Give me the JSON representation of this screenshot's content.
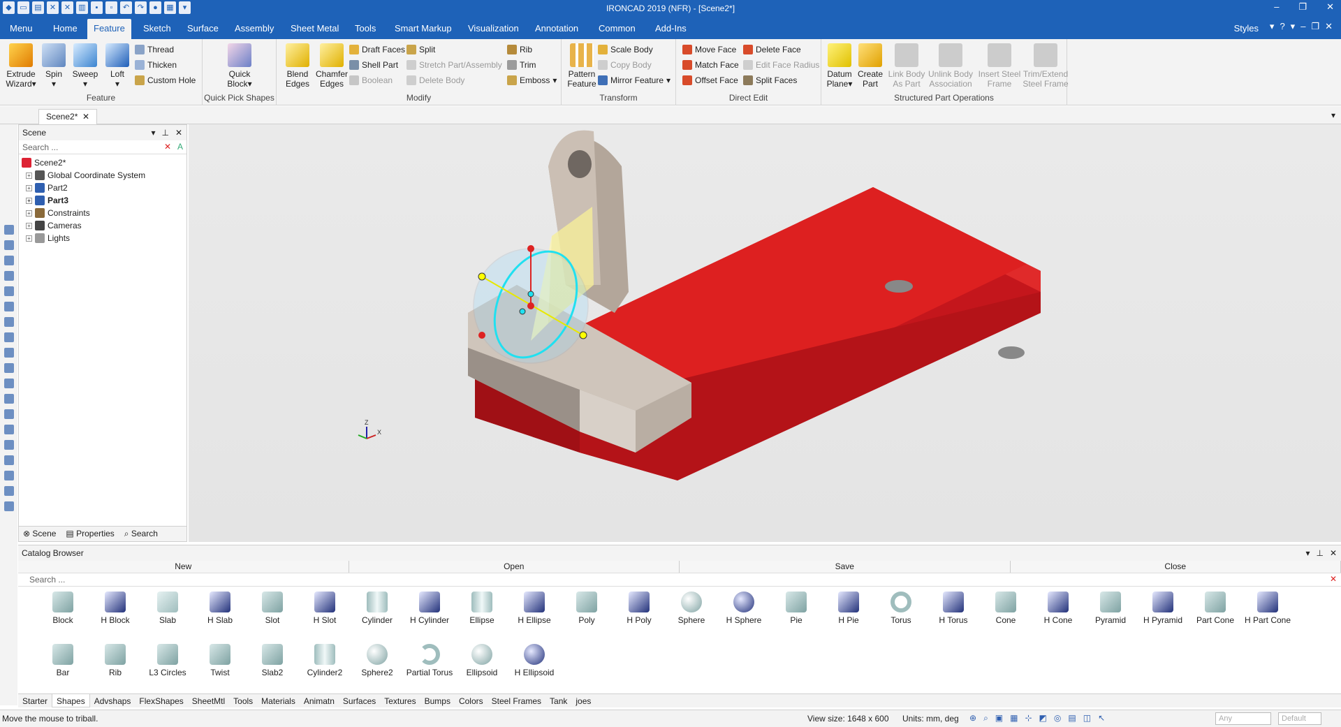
{
  "app": {
    "title": "IRONCAD 2019 (NFR) - [Scene2*]"
  },
  "menu": {
    "items": [
      "Menu",
      "Home",
      "Feature",
      "Sketch",
      "Surface",
      "Assembly",
      "Sheet Metal",
      "Tools",
      "Smart Markup",
      "Visualization",
      "Annotation",
      "Common",
      "Add-Ins"
    ],
    "active": "Feature",
    "styles": "Styles"
  },
  "ribbon": {
    "feature": {
      "label": "Feature",
      "extrude_1": "Extrude",
      "extrude_2": "Wizard",
      "spin": "Spin",
      "sweep": "Sweep",
      "loft": "Loft",
      "thread": "Thread",
      "thicken": "Thicken",
      "custom_hole": "Custom Hole"
    },
    "quick_pick": {
      "label": "Quick Pick Shapes",
      "quick_1": "Quick",
      "quick_2": "Block"
    },
    "modify": {
      "label": "Modify",
      "blend_1": "Blend",
      "blend_2": "Edges",
      "chamfer_1": "Chamfer",
      "chamfer_2": "Edges",
      "draft_faces": "Draft Faces",
      "shell_part": "Shell Part",
      "boolean": "Boolean",
      "split": "Split",
      "stretch": "Stretch Part/Assembly",
      "delete_body": "Delete Body",
      "rib": "Rib",
      "trim": "Trim",
      "emboss": "Emboss"
    },
    "transform": {
      "label": "Transform",
      "pattern_1": "Pattern",
      "pattern_2": "Feature",
      "scale_body": "Scale Body",
      "copy_body": "Copy Body",
      "mirror_feature": "Mirror Feature"
    },
    "direct_edit": {
      "label": "Direct Edit",
      "move_face": "Move Face",
      "match_face": "Match Face",
      "offset_face": "Offset Face",
      "delete_face": "Delete Face",
      "edit_face_radius": "Edit Face Radius",
      "split_faces": "Split Faces"
    },
    "structured": {
      "label": "Structured Part Operations",
      "datum_1": "Datum",
      "datum_2": "Plane",
      "create_1": "Create",
      "create_2": "Part",
      "link_1": "Link Body",
      "link_2": "As Part",
      "unlink_1": "Unlink Body",
      "unlink_2": "Association",
      "insert_1": "Insert Steel",
      "insert_2": "Frame",
      "trim_1": "Trim/Extend",
      "trim_2": "Steel Frame"
    }
  },
  "doc_tab": "Scene2*",
  "scene": {
    "title": "Scene",
    "search_placeholder": "Search ...",
    "root": "Scene2*",
    "nodes": [
      "Global Coordinate System",
      "Part2",
      "Part3",
      "Constraints",
      "Cameras",
      "Lights"
    ],
    "tabs": [
      "Scene",
      "Properties",
      "Search"
    ]
  },
  "catalog": {
    "title": "Catalog Browser",
    "buttons": [
      "New",
      "Open",
      "Save",
      "Close"
    ],
    "search_placeholder": "Search ...",
    "shapes_row1": [
      "Block",
      "H Block",
      "Slab",
      "H Slab",
      "Slot",
      "H Slot",
      "Cylinder",
      "H Cylinder",
      "Ellipse",
      "H Ellipse",
      "Poly",
      "H Poly",
      "Sphere",
      "H Sphere",
      "Pie",
      "H Pie",
      "Torus",
      "H Torus",
      "Cone",
      "H Cone",
      "Pyramid",
      "H Pyramid",
      "Part Cone",
      "H Part Cone"
    ],
    "shapes_row2": [
      "Bar",
      "Rib",
      "L3 Circles",
      "Twist",
      "Slab2",
      "Cylinder2",
      "Sphere2",
      "Partial Torus",
      "Ellipsoid",
      "H Ellipsoid"
    ],
    "tabs": [
      "Starter",
      "Shapes",
      "Advshaps",
      "FlexShapes",
      "SheetMtl",
      "Tools",
      "Materials",
      "Animatn",
      "Surfaces",
      "Textures",
      "Bumps",
      "Colors",
      "Steel Frames",
      "Tank",
      "joes"
    ],
    "active_tab": "Shapes"
  },
  "status": {
    "message": "Move the mouse to triball.",
    "view_size": "View size: 1648 x 600",
    "units": "Units: mm, deg",
    "filter": "Any",
    "style": "Default"
  },
  "triad": {
    "x": "X",
    "z": "Z"
  }
}
